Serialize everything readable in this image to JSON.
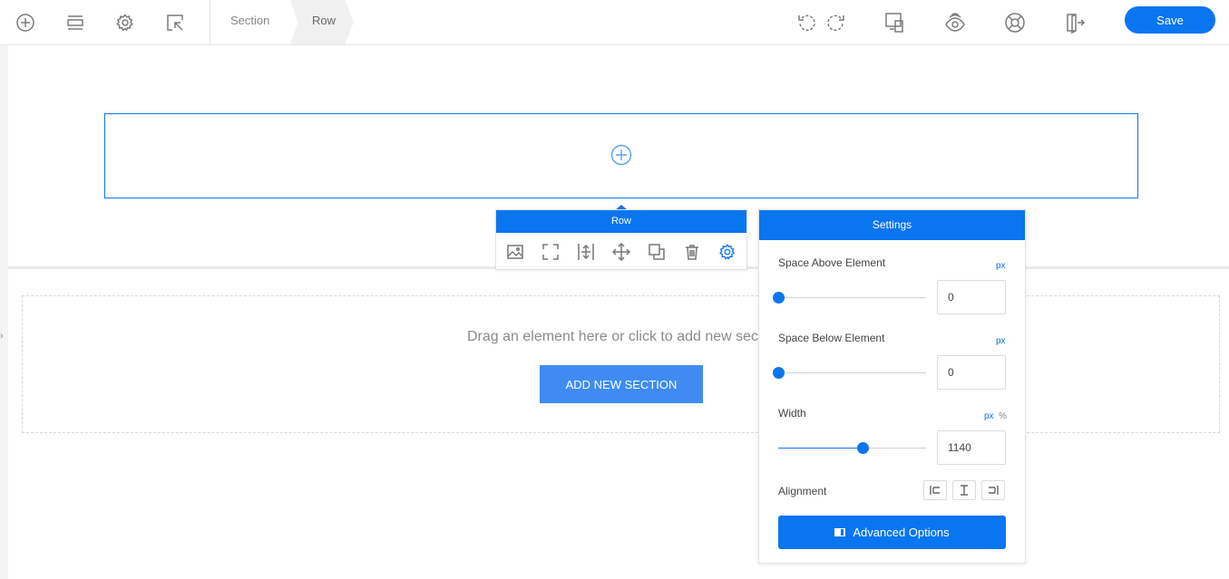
{
  "toolbar": {
    "icons": [
      "add-icon",
      "layers-icon",
      "gear-icon",
      "select-cursor-icon"
    ],
    "breadcrumb": [
      "Section",
      "Row"
    ],
    "right_icons": [
      "undo-icon",
      "redo-icon",
      "responsive-icon",
      "preview-icon",
      "help-icon",
      "exit-icon"
    ],
    "save_label": "Save"
  },
  "canvas": {
    "drop_text": "Drag an element here or click to add new section",
    "add_section_label": "ADD NEW SECTION"
  },
  "row_toolbar": {
    "title": "Row",
    "icons": [
      "image-icon",
      "fullscreen-icon",
      "spacing-icon",
      "move-icon",
      "duplicate-icon",
      "trash-icon",
      "settings-icon"
    ]
  },
  "settings": {
    "title": "Settings",
    "space_above": {
      "label": "Space Above Element",
      "unit": "px",
      "value": "0",
      "level": 0
    },
    "space_below": {
      "label": "Space Below Element",
      "unit": "px",
      "value": "0",
      "level": 0
    },
    "width": {
      "label": "Width",
      "unit_px": "px",
      "unit_pct": "%",
      "value": "1140",
      "level": 0.57
    },
    "alignment": {
      "label": "Alignment",
      "options": [
        "align-left-icon",
        "align-center-icon",
        "align-right-icon"
      ]
    },
    "advanced_label": "Advanced Options"
  },
  "colors": {
    "accent": "#0a75f0",
    "button": "#3e8cf2"
  }
}
